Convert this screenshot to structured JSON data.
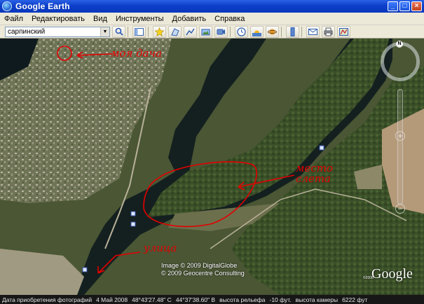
{
  "window": {
    "title": "Google Earth"
  },
  "menu": [
    "Файл",
    "Редактировать",
    "Вид",
    "Инструменты",
    "Добавить",
    "Справка"
  ],
  "search": {
    "value": "сарпинский"
  },
  "toolbar_icons": [
    "search-icon",
    "sidebar-icon",
    "placemark-icon",
    "polygon-icon",
    "path-icon",
    "image-overlay-icon",
    "record-tour-icon",
    "historical-imagery-icon",
    "sun-icon",
    "planets-icon",
    "ruler-icon",
    "email-icon",
    "print-icon",
    "view-in-maps-icon"
  ],
  "annotations": {
    "top": "моя дача",
    "right": "место слета",
    "bottom": "улица"
  },
  "map": {
    "copyright_line1": "Image © 2009 DigitalGlobe",
    "copyright_line2": "© 2009 Geocentre Consulting",
    "logo": "Google",
    "logo_year": "©2008",
    "compass_north": "N"
  },
  "status": {
    "imagery_date_label": "Дата приобретения фотографий",
    "imagery_date": "4 Май 2008",
    "lat": "48°43'27.48\" С",
    "lon": "44°37'38.60\" В",
    "elevation_label": "высота рельефа",
    "elevation": "-10 фут.",
    "eye_label": "высота камеры",
    "eye": "6222 фут"
  }
}
